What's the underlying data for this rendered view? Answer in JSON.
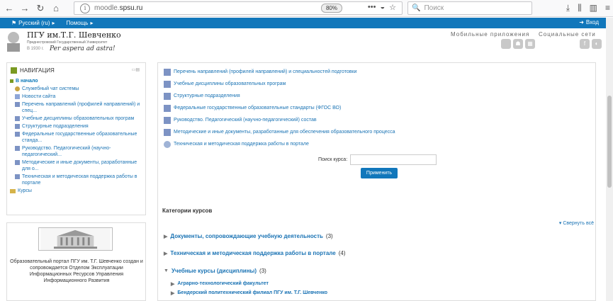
{
  "browser": {
    "url_prefix": "moodle.",
    "url_domain": "spsu.ru",
    "zoom": "80%",
    "search_placeholder": "Поиск"
  },
  "topnav": {
    "language": "Русский (ru)",
    "help": "Помощь",
    "login": "Вход"
  },
  "header": {
    "site_name": "ПГУ им.Т.Г. Шевченко",
    "site_sub": "Приднестровский Государственный Университет",
    "since": "В 1930 г.",
    "motto": "Per aspera ad astra!",
    "mobile_label": "Мобильные приложения",
    "social_label": "Социальные сети"
  },
  "navigation": {
    "title": "НАВИГАЦИЯ",
    "home": "В начало",
    "items": [
      {
        "label": "Служебный чат системы",
        "icon": "chat-icon"
      },
      {
        "label": "Новости сайта",
        "icon": "news-icon"
      },
      {
        "label": "Перечень направлений (профилей направлений) и спец...",
        "icon": "page-icon"
      },
      {
        "label": "Учебные дисциплины образовательных програм",
        "icon": "page-icon"
      },
      {
        "label": "Структурные подразделения",
        "icon": "page-icon"
      },
      {
        "label": "Федеральные государственные образовательные станда...",
        "icon": "page-icon"
      },
      {
        "label": "Руководство. Педагогический (научно-педагогический...",
        "icon": "page-icon"
      },
      {
        "label": "Методические и иные документы, разработанные для о...",
        "icon": "page-icon"
      },
      {
        "label": "Техническая и методическая поддержка работы в портале",
        "icon": "page-icon"
      }
    ],
    "courses": "Курсы"
  },
  "infoblock": {
    "text": "Образовательный портал ПГУ им. Т.Г. Шевченко создан и сопровождается Отделом Эксплуатации Информационных Ресурсов Управления Информационного Развития"
  },
  "main": {
    "links": [
      "Перечень направлений (профилей направлений) и специальностей подготовки",
      "Учебные дисциплины образовательных програм",
      "Структурные подразделения",
      "Федеральные государственные образовательные стандарты (ФГОС ВО)",
      "Руководство. Педагогический (научно-педагогический) состав",
      "Методические и иные документы, разработанные для обеспечения образовательного процесса",
      "Техническая и методическая поддержка работы в портале"
    ],
    "search_label": "Поиск курса:",
    "apply_button": "Применить",
    "categories_title": "Категории курсов",
    "collapse_all": "Свернуть всё",
    "categories": [
      {
        "label": "Документы, сопровождающие учебную деятельность",
        "count": "(3)"
      },
      {
        "label": "Техническая и методическая поддержка работы в портале",
        "count": "(4)"
      },
      {
        "label": "Учебные курсы (дисциплины)",
        "count": "(3)"
      }
    ],
    "subcategories": [
      "Аграрно-технологический факультет",
      "Бендерский политехнический филиал ПГУ им. Т.Г. Шевченко"
    ]
  }
}
